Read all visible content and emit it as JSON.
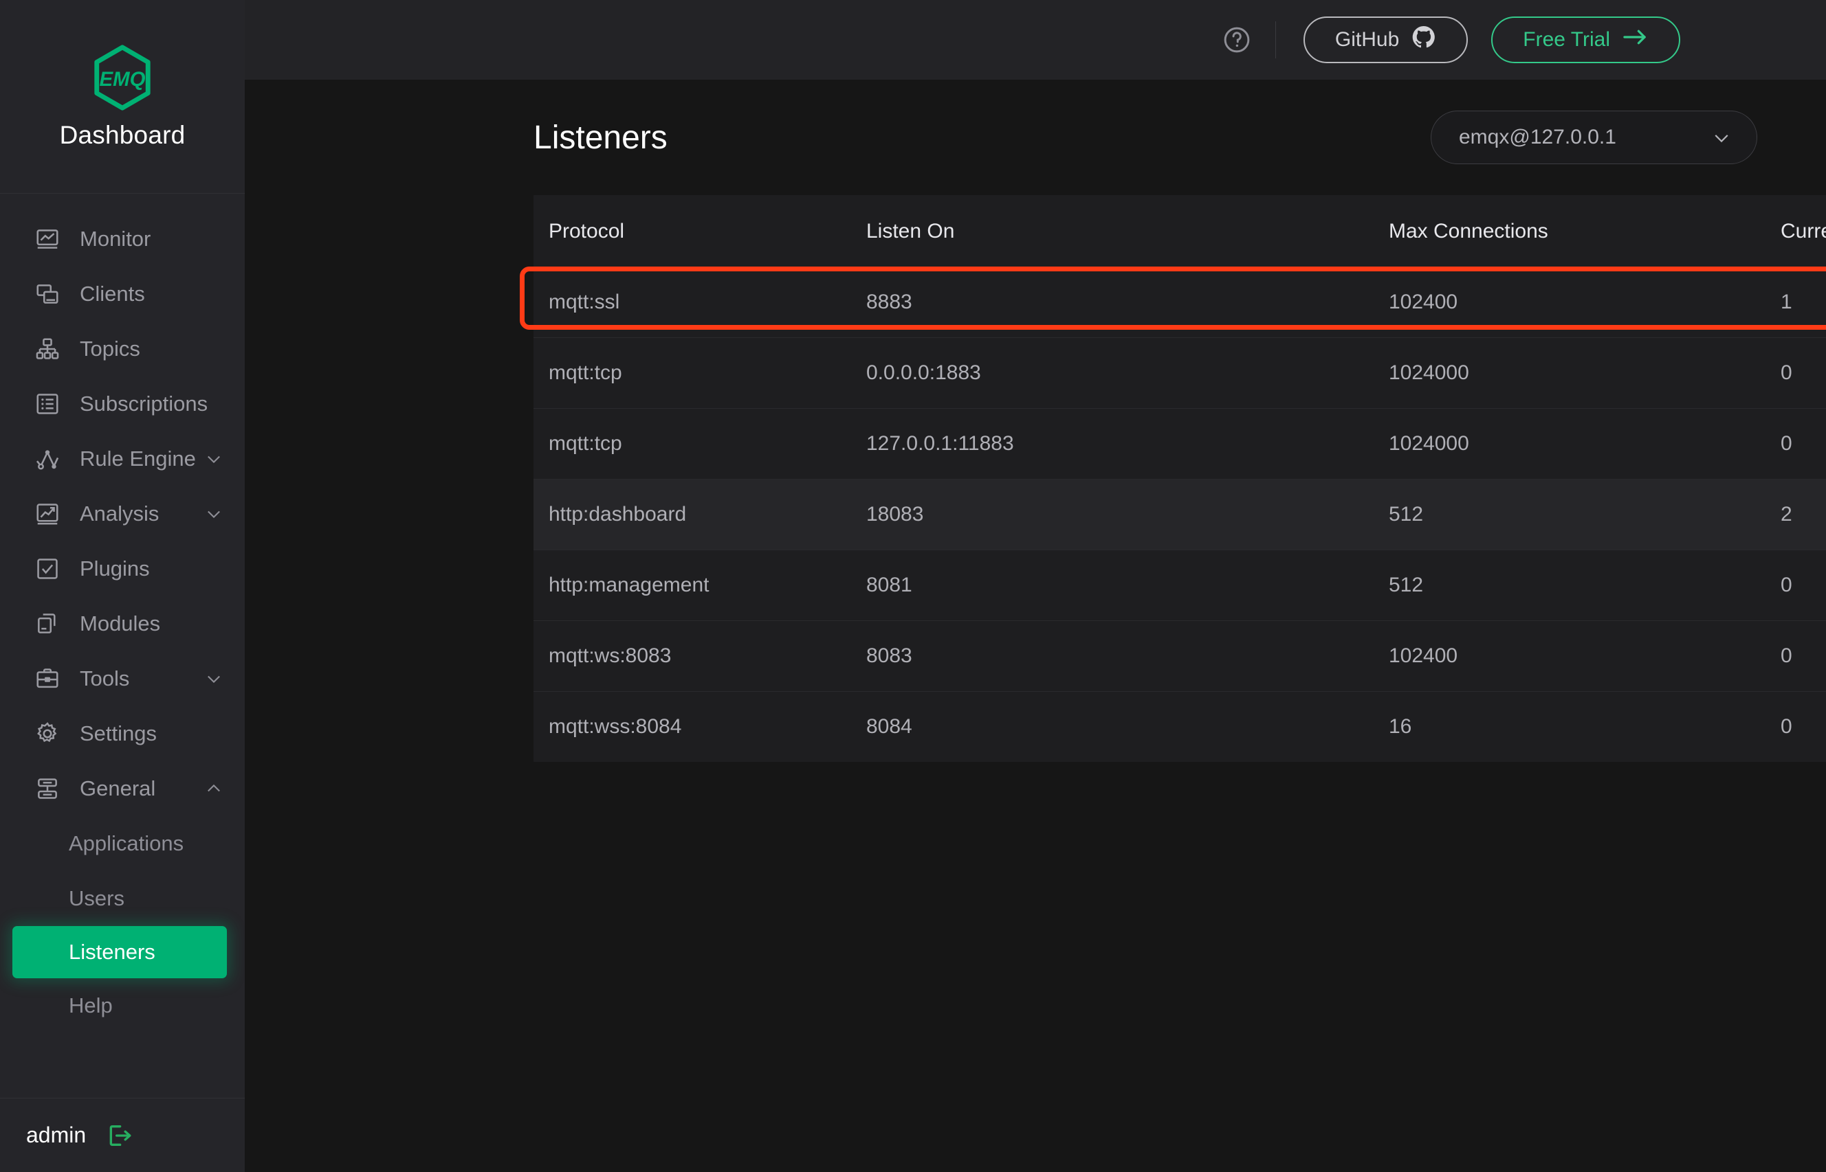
{
  "sidebar": {
    "brand": {
      "logo_text": "EMQ",
      "title": "Dashboard",
      "logo_icon": "emq-hexagon-logo"
    },
    "items": [
      {
        "label": "Monitor",
        "icon": "monitor-icon",
        "expandable": false
      },
      {
        "label": "Clients",
        "icon": "clients-icon",
        "expandable": false
      },
      {
        "label": "Topics",
        "icon": "topics-icon",
        "expandable": false
      },
      {
        "label": "Subscriptions",
        "icon": "subscriptions-icon",
        "expandable": false
      },
      {
        "label": "Rule Engine",
        "icon": "rule-engine-icon",
        "expandable": true,
        "chevron": "chevron-down-icon"
      },
      {
        "label": "Analysis",
        "icon": "analysis-icon",
        "expandable": true,
        "chevron": "chevron-down-icon"
      },
      {
        "label": "Plugins",
        "icon": "plugins-icon",
        "expandable": false
      },
      {
        "label": "Modules",
        "icon": "modules-icon",
        "expandable": false
      },
      {
        "label": "Tools",
        "icon": "tools-icon",
        "expandable": true,
        "chevron": "chevron-down-icon"
      },
      {
        "label": "Settings",
        "icon": "settings-gear-icon",
        "expandable": false
      },
      {
        "label": "General",
        "icon": "general-icon",
        "expandable": true,
        "chevron": "chevron-up-icon",
        "expanded": true
      }
    ],
    "sub_items": [
      {
        "label": "Applications",
        "active": false
      },
      {
        "label": "Users",
        "active": false
      },
      {
        "label": "Listeners",
        "active": true
      },
      {
        "label": "Help",
        "active": false
      }
    ],
    "user": {
      "name": "admin",
      "logout_icon": "logout-icon"
    }
  },
  "topbar": {
    "help_icon": "question-circle-icon",
    "github_label": "GitHub",
    "github_icon": "github-icon",
    "free_trial_label": "Free Trial",
    "free_trial_icon": "arrow-right-icon"
  },
  "main": {
    "title": "Listeners",
    "node_select": {
      "value": "emqx@127.0.0.1",
      "chevron": "chevron-down-icon"
    }
  },
  "table": {
    "columns": [
      "Protocol",
      "Listen On",
      "Max Connections",
      "Current Connections"
    ],
    "rows": [
      {
        "protocol": "mqtt:ssl",
        "listen_on": "8883",
        "max_connections": "102400",
        "current_connections": "1",
        "highlighted": true
      },
      {
        "protocol": "mqtt:tcp",
        "listen_on": "0.0.0.0:1883",
        "max_connections": "1024000",
        "current_connections": "0"
      },
      {
        "protocol": "mqtt:tcp",
        "listen_on": "127.0.0.1:11883",
        "max_connections": "1024000",
        "current_connections": "0"
      },
      {
        "protocol": "http:dashboard",
        "listen_on": "18083",
        "max_connections": "512",
        "current_connections": "2",
        "hovered": true
      },
      {
        "protocol": "http:management",
        "listen_on": "8081",
        "max_connections": "512",
        "current_connections": "0"
      },
      {
        "protocol": "mqtt:ws:8083",
        "listen_on": "8083",
        "max_connections": "102400",
        "current_connections": "0"
      },
      {
        "protocol": "mqtt:wss:8084",
        "listen_on": "8084",
        "max_connections": "16",
        "current_connections": "0"
      }
    ]
  },
  "colors": {
    "page_bg": "#161616",
    "sidebar_bg": "#252529",
    "topbar_bg": "#232326",
    "card_bg": "#1e1e20",
    "row_hover_bg": "#262629",
    "accent_green": "#00b173",
    "mint_green": "#34c98a",
    "highlight_red": "#ff3b16",
    "text_primary": "#ffffff",
    "text_secondary": "#b0b0b6",
    "text_muted": "#9b9ba2"
  }
}
